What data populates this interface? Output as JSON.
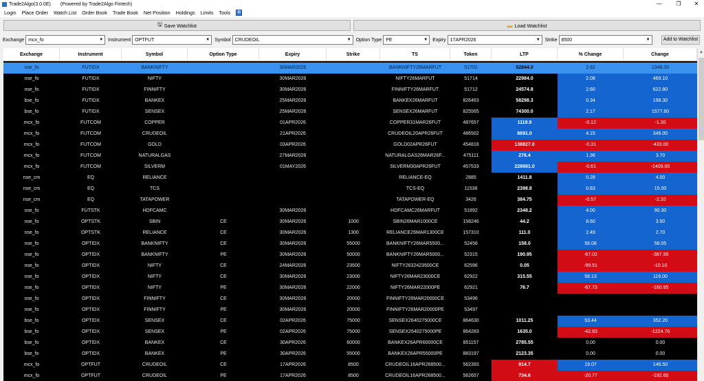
{
  "window": {
    "app_title": "Trade2Algo(3.0.0E)",
    "powered_by": "(Powered by Trade2Algo Fintech)",
    "minimize": "—",
    "maximize": "❐",
    "close": "✕"
  },
  "menu": [
    "Login",
    "Place Order",
    "Watch List",
    "Order Book",
    "Trade Book",
    "Net Position",
    "Holdings",
    "Limits",
    "Tools"
  ],
  "buttons": {
    "save_watchlist": "Save Watchlist",
    "load_watchlist": "Load Watchlist",
    "add_to_watchlist": "Add to Watchlist"
  },
  "filters": {
    "exchange_label": "Exchange",
    "exchange_value": "mcx_fo",
    "instrument_label": "Instrument",
    "instrument_value": "OPTFUT",
    "symbol_label": "Symbol",
    "symbol_value": "CRUDEOIL",
    "option_type_label": "Option Type",
    "option_type_value": "PE",
    "expiry_label": "Expiry",
    "expiry_value": "17APR2026",
    "strike_label": "Strike",
    "strike_value": "8500"
  },
  "grid": {
    "columns": [
      "Exchange",
      "Instrument",
      "Symbol",
      "Option Type",
      "Expiry",
      "Strike",
      "TS",
      "Token",
      "LTP",
      "% Change",
      "Change"
    ],
    "rows": [
      [
        "nse_fo",
        "FUTIDX",
        "BANKNIFTY",
        "",
        "30MAR2026",
        "",
        "BANKNIFTY26MARFUT",
        "51701",
        "52844.0",
        "2.62",
        "1348.00"
      ],
      [
        "nse_fo",
        "FUTIDX",
        "NIFTY",
        "",
        "30MAR2026",
        "",
        "NIFTY26MARFUT",
        "51714",
        "22984.0",
        "2.08",
        "469.10"
      ],
      [
        "nse_fo",
        "FUTIDX",
        "FINNIFTY",
        "",
        "30MAR2026",
        "",
        "FINNIFTY26MARFUT",
        "51712",
        "24574.8",
        "2.60",
        "622.80"
      ],
      [
        "bse_fo",
        "FUTIDX",
        "BANKEX",
        "",
        "25MAR2026",
        "",
        "BANKEX26MARFUT",
        "826463",
        "58298.3",
        "0.34",
        "198.30"
      ],
      [
        "bse_fo",
        "FUTIDX",
        "SENSEX",
        "",
        "25MAR2026",
        "",
        "SENSEX26MARFUT",
        "825565",
        "74300.0",
        "2.17",
        "1577.60"
      ],
      [
        "mcx_fo",
        "FUTCOM",
        "COPPER",
        "",
        "01APR2026",
        "",
        "COPPER31MAR26FUT",
        "487657",
        "1119.9",
        "-0.12",
        "-1.30"
      ],
      [
        "mcx_fo",
        "FUTCOM",
        "CRUDEOIL",
        "",
        "21APR2026",
        "",
        "CRUDEOIL20APR26FUT",
        "486502",
        "8691.0",
        "4.15",
        "346.00"
      ],
      [
        "mcx_fo",
        "FUTCOM",
        "GOLD",
        "",
        "03APR2026",
        "",
        "GOLD02APR26FUT",
        "454818",
        "138827.0",
        "-0.31",
        "-433.00"
      ],
      [
        "mcx_fo",
        "FUTCOM",
        "NATURALGAS",
        "",
        "27MAR2026",
        "",
        "NATURALGAS26MAR26F...",
        "475111",
        "276.4",
        "1.36",
        "3.70"
      ],
      [
        "mcx_fo",
        "FUTCOM",
        "SILVERM",
        "",
        "01MAY2026",
        "",
        "SILVERM30APR26FUT",
        "457533",
        "228681.0",
        "-0.61",
        "-1409.00"
      ],
      [
        "nse_cm",
        "EQ",
        "RELIANCE",
        "",
        "",
        "",
        "RELIANCE-EQ",
        "2885",
        "1411.8",
        "0.28",
        "4.00"
      ],
      [
        "nse_cm",
        "EQ",
        "TCS",
        "",
        "",
        "",
        "TCS-EQ",
        "11536",
        "2398.8",
        "0.63",
        "15.00"
      ],
      [
        "nse_cm",
        "EQ",
        "TATAPOWER",
        "",
        "",
        "",
        "TATAPOWER-EQ",
        "3426",
        "384.75",
        "-0.57",
        "-2.20"
      ],
      [
        "nse_fo",
        "FUTSTK",
        "HDFCAMC",
        "",
        "30MAR2026",
        "",
        "HDFCAMC26MARFUT",
        "51892",
        "2348.2",
        "4.00",
        "90.30"
      ],
      [
        "nse_fo",
        "OPTSTK",
        "SBIN",
        "CE",
        "30MAR2026",
        "1000",
        "SBIN26MAR1000CE",
        "158246",
        "44.2",
        "8.60",
        "3.50"
      ],
      [
        "nse_fo",
        "OPTSTK",
        "RELIANCE",
        "CE",
        "30MAR2026",
        "1300",
        "RELIANCE26MAR1300CE",
        "157310",
        "111.0",
        "2.49",
        "2.70"
      ],
      [
        "nse_fo",
        "OPTIDX",
        "BANKNIFTY",
        "CE",
        "30MAR2026",
        "55000",
        "BANKNIFTY26MAR5500...",
        "52456",
        "158.0",
        "58.08",
        "58.05"
      ],
      [
        "nse_fo",
        "OPTIDX",
        "BANKNIFTY",
        "PE",
        "30MAR2026",
        "50000",
        "BANKNIFTY26MAR5000...",
        "52315",
        "190.95",
        "-67.02",
        "-387.95"
      ],
      [
        "nse_fo",
        "OPTIDX",
        "NIFTY",
        "CE",
        "24MAR2026",
        "23500",
        "NIFTY2632423500CE",
        "62596",
        "0.05",
        "-99.51",
        "-10.10"
      ],
      [
        "nse_fo",
        "OPTIDX",
        "NIFTY",
        "CE",
        "30MAR2026",
        "23000",
        "NIFTY26MAR23000CE",
        "62922",
        "315.55",
        "58.13",
        "116.00"
      ],
      [
        "nse_fo",
        "OPTIDX",
        "NIFTY",
        "PE",
        "30MAR2026",
        "22000",
        "NIFTY26MAR22000PE",
        "62921",
        "76.7",
        "-67.73",
        "-160.95"
      ],
      [
        "nse_fo",
        "OPTIDX",
        "FINNIFTY",
        "CE",
        "30MAR2026",
        "20000",
        "FINNIFTY26MAR20000CE",
        "53496",
        "",
        "",
        ""
      ],
      [
        "nse_fo",
        "OPTIDX",
        "FINNIFTY",
        "PE",
        "30MAR2026",
        "20000",
        "FINNIFTY26MAR20000PE",
        "53497",
        "",
        "",
        ""
      ],
      [
        "bse_fo",
        "OPTIDX",
        "SENSEX",
        "CE",
        "02APR2026",
        "75000",
        "SENSEX2640275000CE",
        "864630",
        "1011.25",
        "53.44",
        "352.20"
      ],
      [
        "bse_fo",
        "OPTIDX",
        "SENSEX",
        "PE",
        "02APR2026",
        "75000",
        "SENSEX2640275000PE",
        "864283",
        "1635.0",
        "-42.83",
        "-1224.70"
      ],
      [
        "bse_fo",
        "OPTIDX",
        "BANKEX",
        "CE",
        "30APR2026",
        "60000",
        "BANKEX26APR60000CE",
        "851157",
        "2785.55",
        "0.00",
        "0.00"
      ],
      [
        "bse_fo",
        "OPTIDX",
        "BANKEX",
        "PE",
        "30APR2026",
        "55000",
        "BANKEX26APR55000PE",
        "883197",
        "2123.35",
        "0.00",
        "0.00"
      ],
      [
        "mcx_fo",
        "OPTFUT",
        "CRUDEOIL",
        "CE",
        "17APR2026",
        "8500",
        "CRUDEOIL16APR268500...",
        "562393",
        "914.7",
        "19.07",
        "146.50"
      ],
      [
        "mcx_fo",
        "OPTFUT",
        "CRUDEOIL",
        "PE",
        "17APR2026",
        "8500",
        "CRUDEOIL16APR268500...",
        "562657",
        "734.6",
        "-20.77",
        "-192.60"
      ]
    ],
    "ltp_colors": [
      "",
      "",
      "",
      "",
      "",
      "up",
      "up",
      "dn",
      "up",
      "up",
      "",
      "",
      "",
      "",
      "",
      "",
      "",
      "",
      "",
      "",
      "",
      "",
      "",
      "",
      "",
      "",
      "",
      "dn",
      "dn"
    ],
    "selected_row": 0
  },
  "colors": {
    "up": "#1565d0",
    "down": "#d10c14",
    "selected": "#3a92ee",
    "grid_bg": "#000000"
  }
}
